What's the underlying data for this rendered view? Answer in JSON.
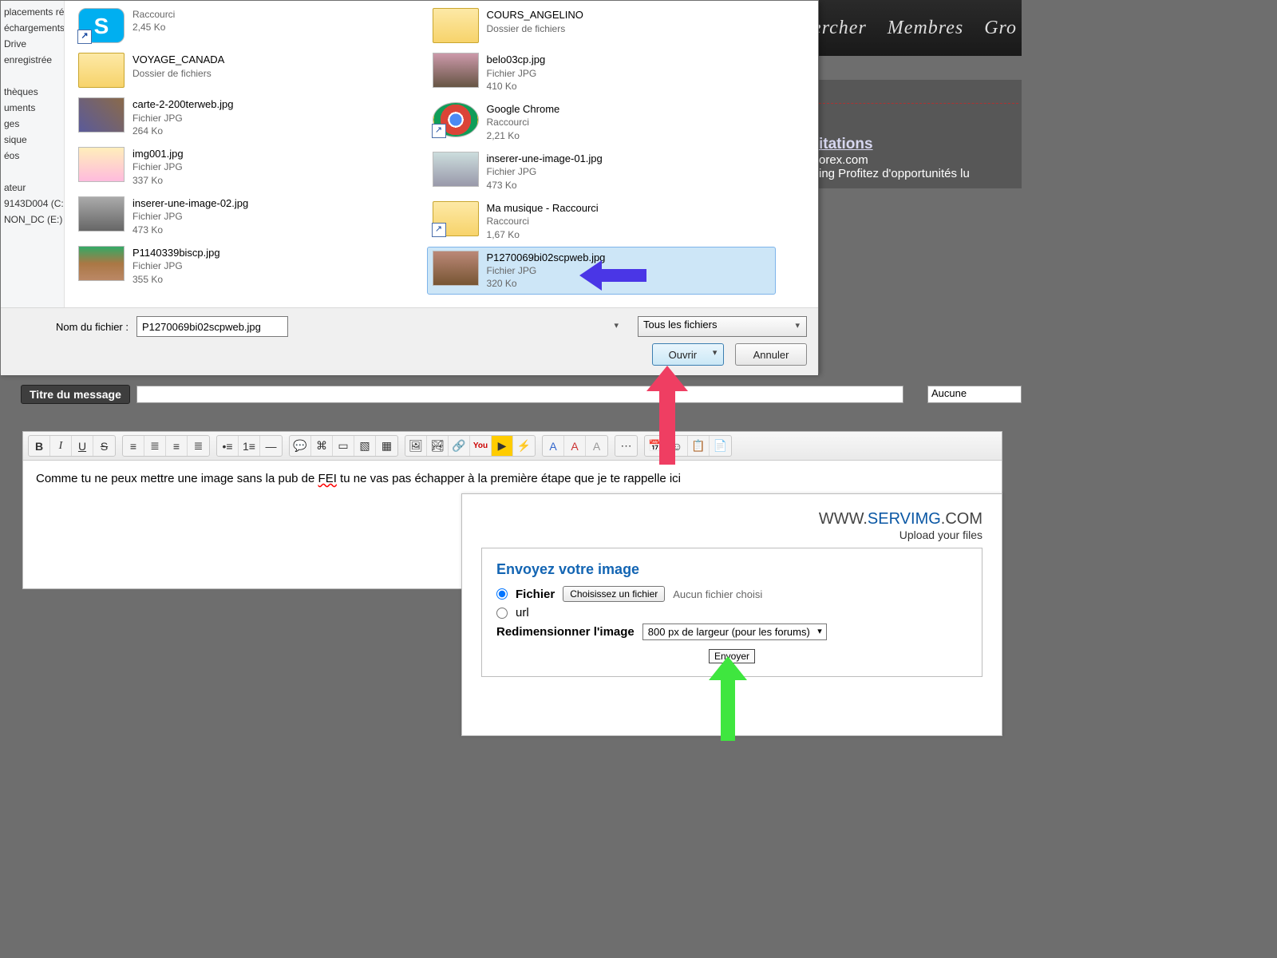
{
  "dialog": {
    "sidebar": [
      "placements ré",
      "échargements",
      "Drive",
      "enregistrée",
      "",
      "thèques",
      "uments",
      "ges",
      "sique",
      "éos",
      "",
      "ateur",
      "9143D004 (C:",
      "NON_DC (E:)"
    ],
    "col1": [
      {
        "thumb": "skype",
        "shortcut": true,
        "name": "",
        "type": "Raccourci",
        "size": "2,45 Ko"
      },
      {
        "thumb": "folder",
        "shortcut": false,
        "name": "VOYAGE_CANADA",
        "type": "Dossier de fichiers",
        "size": ""
      },
      {
        "thumb": "img1",
        "shortcut": false,
        "name": "carte-2-200terweb.jpg",
        "type": "Fichier JPG",
        "size": "264 Ko"
      },
      {
        "thumb": "img4",
        "shortcut": false,
        "name": "img001.jpg",
        "type": "Fichier JPG",
        "size": "337 Ko"
      },
      {
        "thumb": "img5",
        "shortcut": false,
        "name": "inserer-une-image-02.jpg",
        "type": "Fichier JPG",
        "size": "473 Ko"
      },
      {
        "thumb": "img6",
        "shortcut": false,
        "name": "P1140339biscp.jpg",
        "type": "Fichier JPG",
        "size": "355 Ko"
      }
    ],
    "col2": [
      {
        "thumb": "folder",
        "shortcut": false,
        "name": "COURS_ANGELINO",
        "type": "Dossier de fichiers",
        "size": ""
      },
      {
        "thumb": "img2",
        "shortcut": false,
        "name": "belo03cp.jpg",
        "type": "Fichier JPG",
        "size": "410 Ko"
      },
      {
        "thumb": "chrome",
        "shortcut": true,
        "name": "Google Chrome",
        "type": "Raccourci",
        "size": "2,21 Ko"
      },
      {
        "thumb": "img3",
        "shortcut": false,
        "name": "inserer-une-image-01.jpg",
        "type": "Fichier JPG",
        "size": "473 Ko"
      },
      {
        "thumb": "folder",
        "shortcut": true,
        "name": "Ma musique - Raccourci",
        "type": "Raccourci",
        "size": "1,67 Ko"
      },
      {
        "thumb": "img7",
        "shortcut": false,
        "name": "P1270069bi02scpweb.jpg",
        "type": "Fichier JPG",
        "size": "320 Ko",
        "selected": true
      }
    ],
    "filename_label": "Nom du fichier :",
    "filename_value": "P1270069bi02scpweb.jpg",
    "filter": "Tous les fichiers",
    "open": "Ouvrir",
    "cancel": "Annuler"
  },
  "header_links": [
    "Rechercher",
    "Membres",
    "Gro"
  ],
  "right_panel": {
    "title": "itations",
    "l1": "orex.com",
    "l2": "ing Profitez d'opportunités lu"
  },
  "title_row": {
    "label": "Titre du message",
    "select": "Aucune"
  },
  "editor": {
    "text_a": "Comme tu ne peux mettre une image sans la pub de ",
    "text_fei": "FEI",
    "text_b": "   tu ne vas pas échapper à la première étape que je te rappelle ici"
  },
  "servimg": {
    "brand_a": "WWW.",
    "brand_b": "SERVIMG",
    "brand_c": ".COM",
    "sub": "Upload your files",
    "heading": "Envoyez votre image",
    "opt_file": "Fichier",
    "choose": "Choisissez un fichier",
    "nofile": "Aucun fichier choisi",
    "opt_url": "url",
    "resize": "Redimensionner l'image",
    "resize_opt": "800 px de largeur (pour les forums)",
    "send": "Envoyer"
  }
}
